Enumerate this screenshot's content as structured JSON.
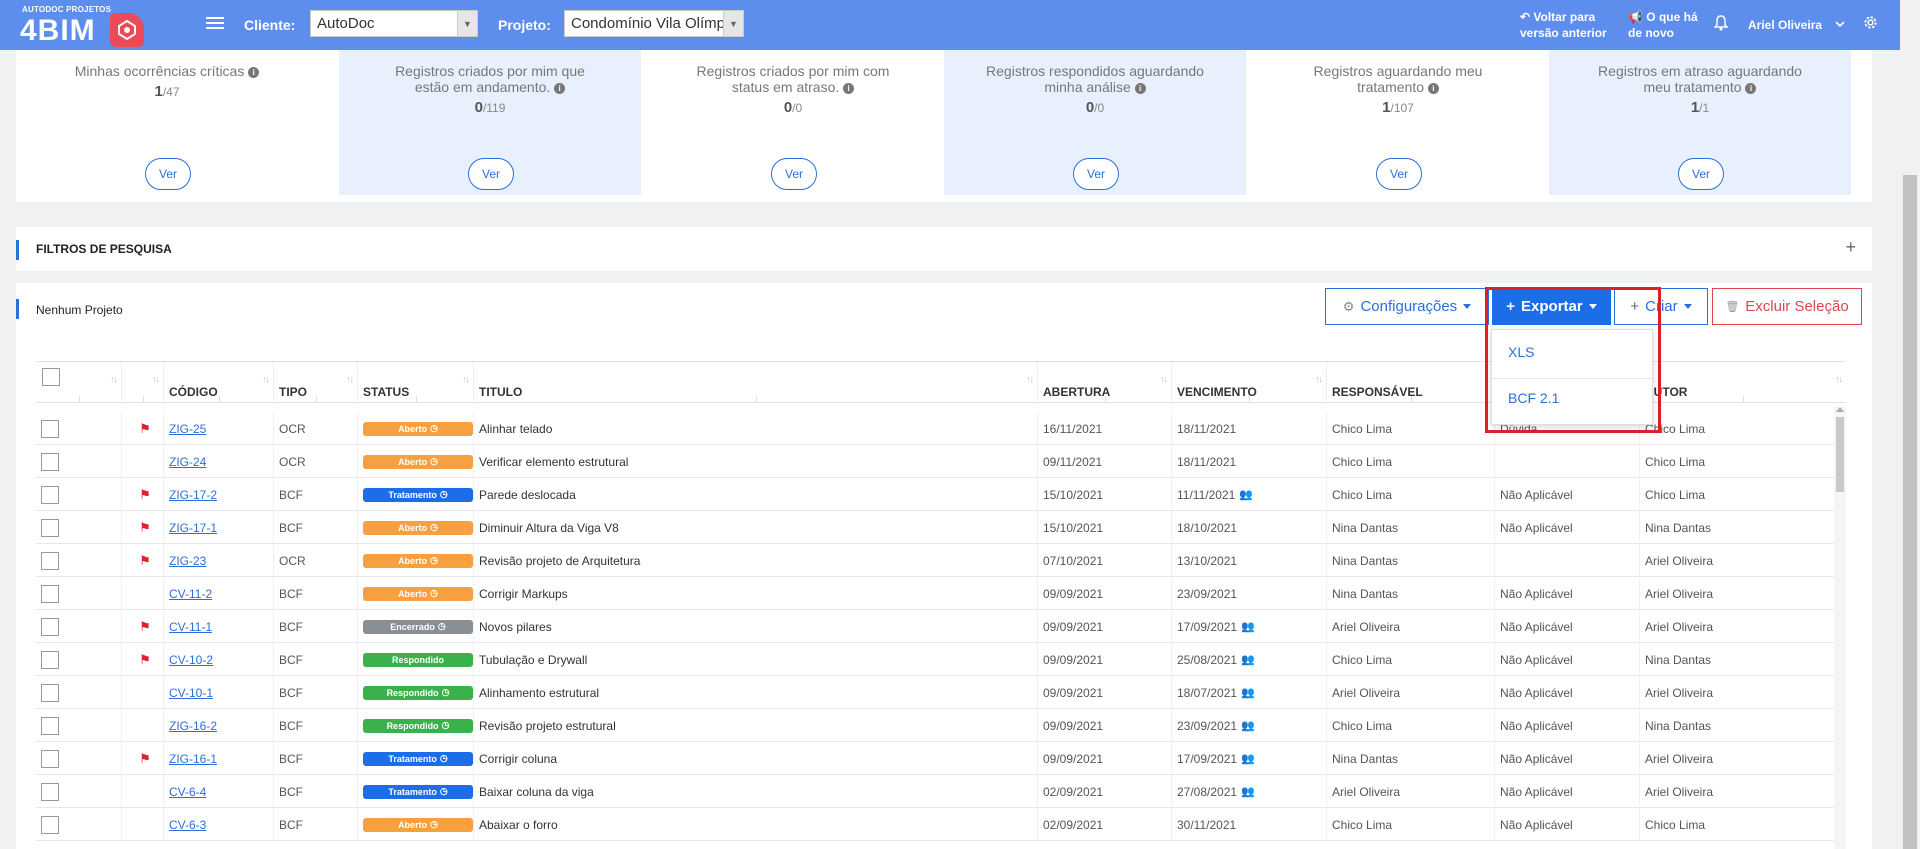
{
  "header": {
    "logo_small": "AUTODOC PROJETOS",
    "logo_big": "4BIM",
    "client_label": "Cliente:",
    "client_value": "AutoDoc",
    "project_label": "Projeto:",
    "project_value": "Condomínio Vila Olímpia",
    "back_line1": "Voltar para",
    "back_line2": "versão anterior",
    "news_line1": "O que há",
    "news_line2": "de novo",
    "user_name": "Ariel Oliveira",
    "brand_color": "#5d8ded"
  },
  "stats": [
    {
      "title": "Minhas ocorrências críticas",
      "value": "1",
      "total": "/47",
      "button": "Ver"
    },
    {
      "title": "Registros criados por mim que estão em andamento.",
      "value": "0",
      "total": "/119",
      "button": "Ver"
    },
    {
      "title": "Registros criados por mim com status em atraso.",
      "value": "0",
      "total": "/0",
      "button": "Ver"
    },
    {
      "title": "Registros respondidos aguardando minha análise",
      "value": "0",
      "total": "/0",
      "button": "Ver"
    },
    {
      "title": "Registros aguardando meu tratamento",
      "value": "1",
      "total": "/107",
      "button": "Ver"
    },
    {
      "title": "Registros em atraso aguardando meu tratamento",
      "value": "1",
      "total": "/1",
      "button": "Ver"
    }
  ],
  "filters": {
    "title": "FILTROS DE PESQUISA"
  },
  "panel": {
    "title": "Nenhum Projeto",
    "config_button": "Configurações",
    "export_button": "Exportar",
    "create_button": "Criar",
    "delete_button": "Excluir Seleção",
    "export_menu": [
      "XLS",
      "BCF 2.1"
    ]
  },
  "table": {
    "columns": [
      "CÓDIGO",
      "TIPO",
      "STATUS",
      "TITULO",
      "ABERTURA",
      "VENCIMENTO",
      "RESPONSÁVEL",
      "",
      "AUTOR"
    ],
    "rows": [
      {
        "flag": true,
        "code": "ZIG-25",
        "type": "OCR",
        "status": "Aberto",
        "status_color": "#f7a041",
        "clock": true,
        "title": "Alinhar telado",
        "open": "16/11/2021",
        "due": "18/11/2021",
        "group": false,
        "resp": "Chico Lima",
        "extra": "Dúvida",
        "author": "Chico Lima"
      },
      {
        "flag": false,
        "code": "ZIG-24",
        "type": "OCR",
        "status": "Aberto",
        "status_color": "#f7a041",
        "clock": true,
        "title": "Verificar elemento estrutural",
        "open": "09/11/2021",
        "due": "18/11/2021",
        "group": false,
        "resp": "Chico Lima",
        "extra": "",
        "author": "Chico Lima"
      },
      {
        "flag": true,
        "code": "ZIG-17-2",
        "type": "BCF",
        "status": "Tratamento",
        "status_color": "#1b6ee8",
        "clock": true,
        "title": "Parede deslocada",
        "open": "15/10/2021",
        "due": "11/11/2021",
        "group": true,
        "resp": "Chico Lima",
        "extra": "Não Aplicável",
        "author": "Chico Lima"
      },
      {
        "flag": true,
        "code": "ZIG-17-1",
        "type": "BCF",
        "status": "Aberto",
        "status_color": "#f7a041",
        "clock": true,
        "title": "Diminuir Altura da Viga V8",
        "open": "15/10/2021",
        "due": "18/10/2021",
        "group": false,
        "resp": "Nina Dantas",
        "extra": "Não Aplicável",
        "author": "Nina Dantas"
      },
      {
        "flag": true,
        "code": "ZIG-23",
        "type": "OCR",
        "status": "Aberto",
        "status_color": "#f7a041",
        "clock": true,
        "title": "Revisão projeto de Arquitetura",
        "open": "07/10/2021",
        "due": "13/10/2021",
        "group": false,
        "resp": "Nina Dantas",
        "extra": "",
        "author": "Ariel Oliveira"
      },
      {
        "flag": false,
        "code": "CV-11-2",
        "type": "BCF",
        "status": "Aberto",
        "status_color": "#f7a041",
        "clock": true,
        "title": "Corrigir Markups",
        "open": "09/09/2021",
        "due": "23/09/2021",
        "group": false,
        "resp": "Nina Dantas",
        "extra": "Não Aplicável",
        "author": "Ariel Oliveira"
      },
      {
        "flag": true,
        "code": "CV-11-1",
        "type": "BCF",
        "status": "Encerrado",
        "status_color": "#8a8f95",
        "clock": true,
        "title": "Novos pilares",
        "open": "09/09/2021",
        "due": "17/09/2021",
        "group": true,
        "resp": "Ariel Oliveira",
        "extra": "Não Aplicável",
        "author": "Ariel Oliveira"
      },
      {
        "flag": true,
        "code": "CV-10-2",
        "type": "BCF",
        "status": "Respondido",
        "status_color": "#3ab14a",
        "clock": false,
        "title": "Tubulação e Drywall",
        "open": "09/09/2021",
        "due": "25/08/2021",
        "group": true,
        "resp": "Chico Lima",
        "extra": "Não Aplicável",
        "author": "Nina Dantas"
      },
      {
        "flag": false,
        "code": "CV-10-1",
        "type": "BCF",
        "status": "Respondido",
        "status_color": "#3ab14a",
        "clock": true,
        "title": "Alinhamento estrutural",
        "open": "09/09/2021",
        "due": "18/07/2021",
        "group": true,
        "resp": "Ariel Oliveira",
        "extra": "Não Aplicável",
        "author": "Ariel Oliveira"
      },
      {
        "flag": false,
        "code": "ZIG-16-2",
        "type": "BCF",
        "status": "Respondido",
        "status_color": "#3ab14a",
        "clock": true,
        "title": "Revisão projeto estrutural",
        "open": "09/09/2021",
        "due": "23/09/2021",
        "group": true,
        "resp": "Chico Lima",
        "extra": "Não Aplicável",
        "author": "Nina Dantas"
      },
      {
        "flag": true,
        "code": "ZIG-16-1",
        "type": "BCF",
        "status": "Tratamento",
        "status_color": "#1b6ee8",
        "clock": true,
        "title": "Corrigir coluna",
        "open": "09/09/2021",
        "due": "17/09/2021",
        "group": true,
        "resp": "Nina Dantas",
        "extra": "Não Aplicável",
        "author": "Ariel Oliveira"
      },
      {
        "flag": false,
        "code": "CV-6-4",
        "type": "BCF",
        "status": "Tratamento",
        "status_color": "#1b6ee8",
        "clock": true,
        "title": "Baixar coluna da viga",
        "open": "02/09/2021",
        "due": "27/08/2021",
        "group": true,
        "resp": "Ariel Oliveira",
        "extra": "Não Aplicável",
        "author": "Ariel Oliveira"
      },
      {
        "flag": false,
        "code": "CV-6-3",
        "type": "BCF",
        "status": "Aberto",
        "status_color": "#f7a041",
        "clock": true,
        "title": "Abaixar o forro",
        "open": "02/09/2021",
        "due": "30/11/2021",
        "group": false,
        "resp": "Chico Lima",
        "extra": "Não Aplicável",
        "author": "Chico Lima"
      }
    ]
  }
}
